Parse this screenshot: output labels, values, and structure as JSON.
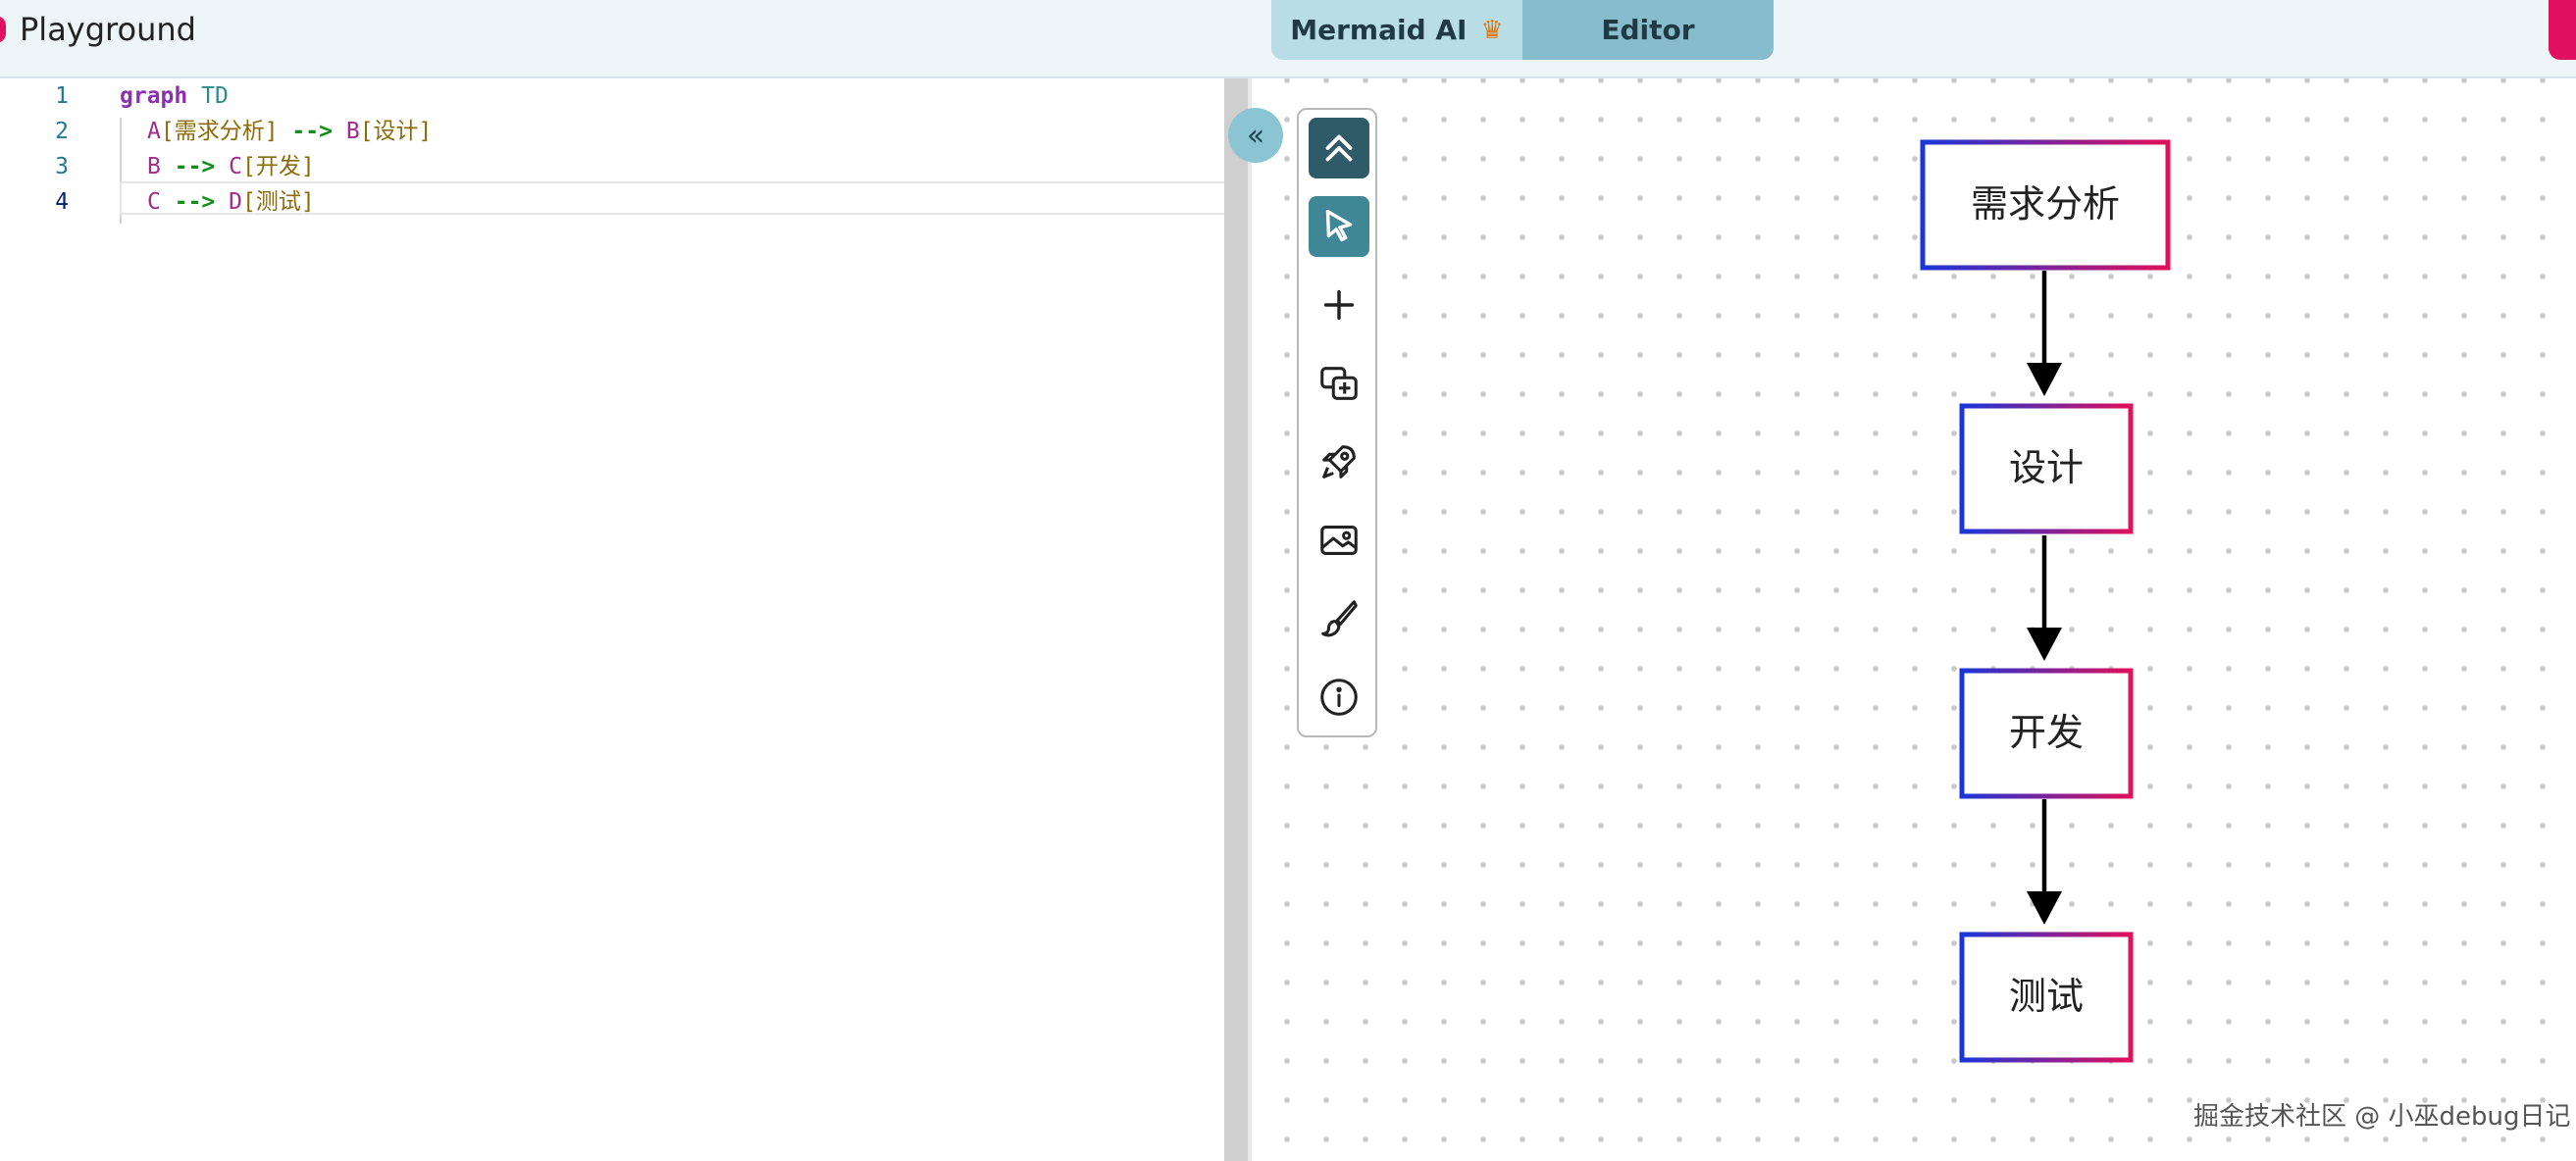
{
  "header": {
    "title": "Playground",
    "tabs": [
      {
        "label": "Mermaid AI",
        "icon": "crown-icon"
      },
      {
        "label": "Editor"
      }
    ]
  },
  "editor": {
    "lines": [
      {
        "number": "1"
      },
      {
        "number": "2"
      },
      {
        "number": "3"
      },
      {
        "number": "4"
      }
    ],
    "code": {
      "l1_kw": "graph",
      "l1_dir": "TD",
      "l2_a": "A",
      "l2_a_label": "[需求分析]",
      "l2_arrow": "-->",
      "l2_b": "B",
      "l2_b_label": "[设计]",
      "l3_b": "B",
      "l3_arrow": "-->",
      "l3_c": "C",
      "l3_c_label": "[开发]",
      "l4_c": "C",
      "l4_arrow": "-->",
      "l4_d": "D",
      "l4_d_label": "[测试]"
    }
  },
  "toolbar": {
    "tools": [
      "chevrons-up-icon",
      "pointer-icon",
      "plus-icon",
      "add-shape-icon",
      "rocket-icon",
      "image-icon",
      "brush-icon",
      "info-icon"
    ]
  },
  "diagram": {
    "nodes": [
      {
        "id": "A",
        "label": "需求分析"
      },
      {
        "id": "B",
        "label": "设计"
      },
      {
        "id": "C",
        "label": "开发"
      },
      {
        "id": "D",
        "label": "测试"
      }
    ],
    "edges": [
      [
        "A",
        "B"
      ],
      [
        "B",
        "C"
      ],
      [
        "C",
        "D"
      ]
    ],
    "border_gradient": [
      "#1a36d8",
      "#e0105a"
    ]
  },
  "watermark": "掘金技术社区 @ 小巫debug日记",
  "colors": {
    "accent": "#e0115f",
    "tab_ai": "#b9dde6",
    "tab_editor": "#86bccb"
  }
}
